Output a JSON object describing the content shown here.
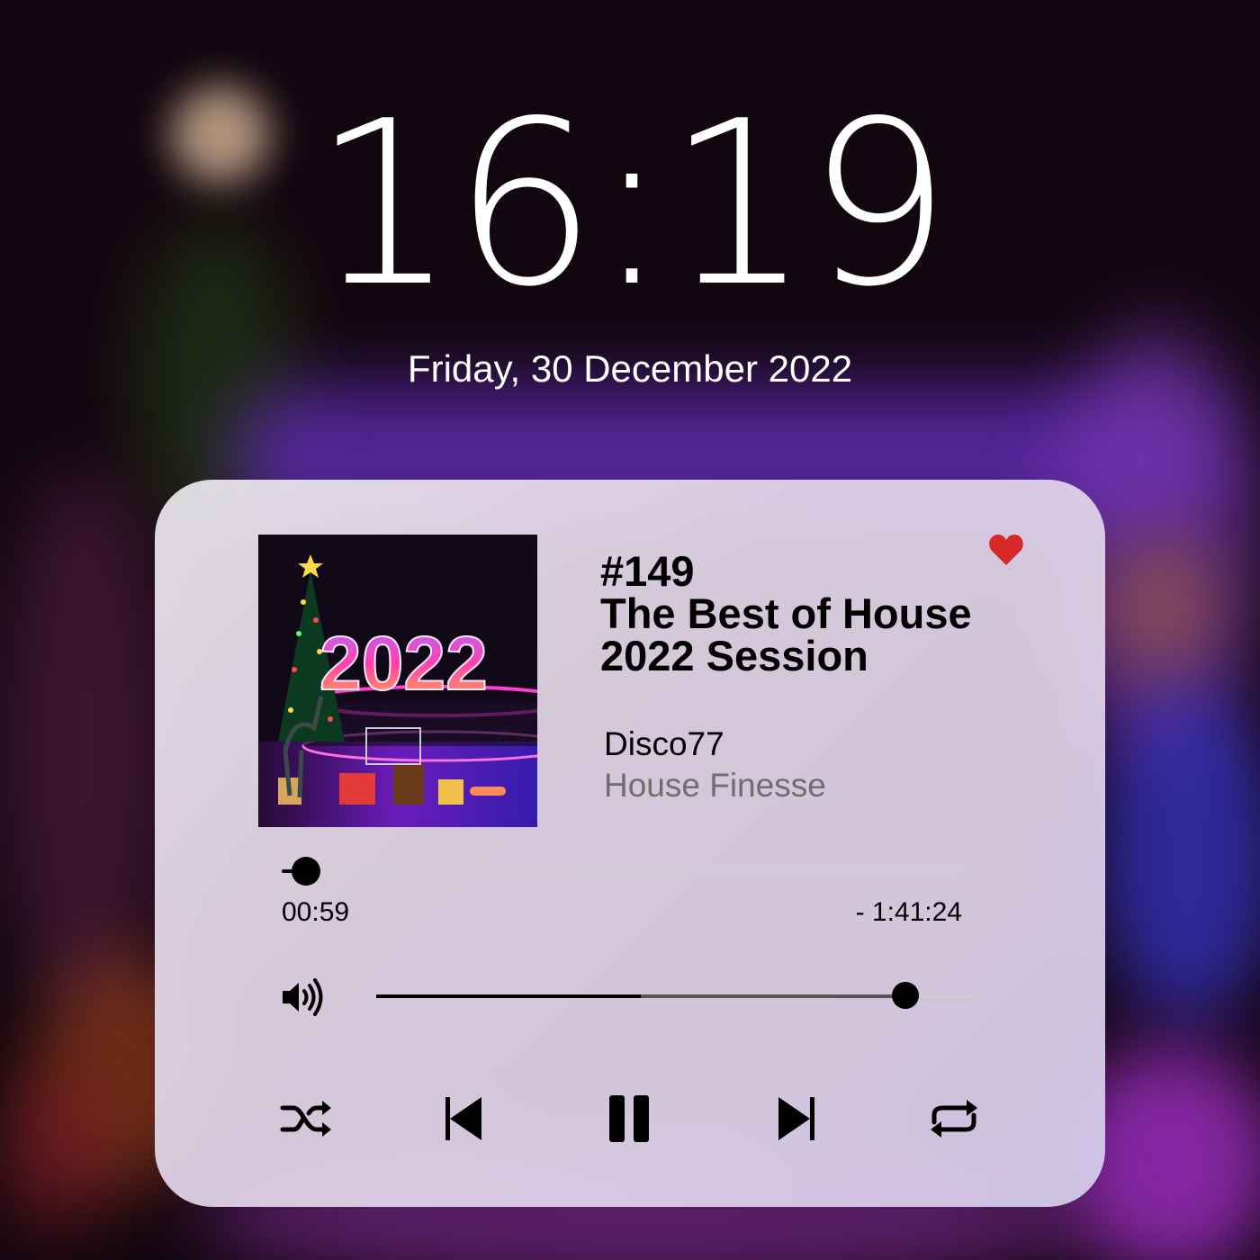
{
  "lockscreen": {
    "time": "16:19",
    "date": "Friday, 30 December 2022"
  },
  "player": {
    "artwork_text": "2022",
    "title_lines": [
      "#149",
      "The Best of House",
      "2022 Session"
    ],
    "artist": "Disco77",
    "album": "House Finesse",
    "liked": true,
    "like_color": "#d6292a",
    "elapsed": "00:59",
    "remaining": "- 1:41:24",
    "progress_fraction": 0.035,
    "volume_fraction": 0.88,
    "controls": {
      "shuffle": "shuffle-icon",
      "previous": "previous-icon",
      "play_pause": "pause-icon",
      "next": "next-icon",
      "repeat": "repeat-icon"
    }
  }
}
